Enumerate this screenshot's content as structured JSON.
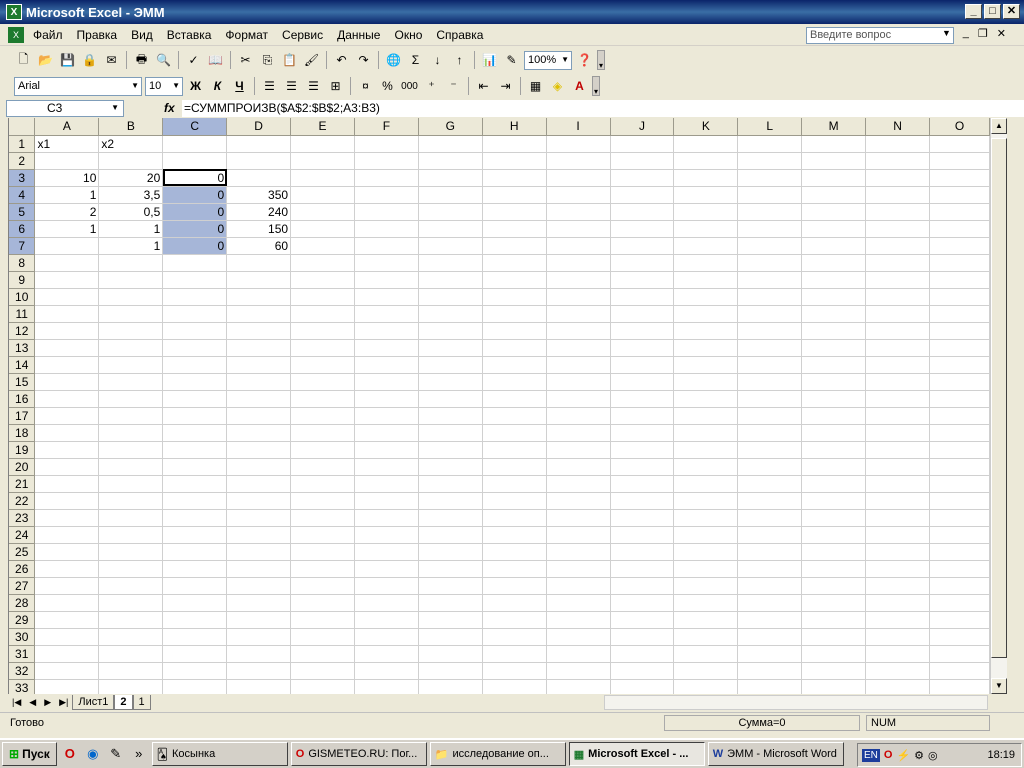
{
  "window": {
    "title": "Microsoft Excel - ЭММ",
    "min": "_",
    "max": "□",
    "close": "✕"
  },
  "menu": [
    "Файл",
    "Правка",
    "Вид",
    "Вставка",
    "Формат",
    "Сервис",
    "Данные",
    "Окно",
    "Справка"
  ],
  "ask": {
    "placeholder": "Введите вопрос"
  },
  "toolbar": {
    "zoom": "100%",
    "font": "Arial",
    "size": "10",
    "bold": "Ж",
    "italic": "К",
    "underline": "Ч",
    "percent": "%",
    "thousands": "000",
    "sigma": "Σ"
  },
  "formula_bar": {
    "name": "C3",
    "fx": "fx",
    "formula": "=СУММПРОИЗВ($A$2:$B$2;A3:B3)"
  },
  "columns": [
    "A",
    "B",
    "C",
    "D",
    "E",
    "F",
    "G",
    "H",
    "I",
    "J",
    "K",
    "L",
    "M",
    "N",
    "O"
  ],
  "cells": {
    "A1": "x1",
    "B1": "x2",
    "A3": "10",
    "B3": "20",
    "C3": "0",
    "A4": "1",
    "B4": "3,5",
    "C4": "0",
    "D4": "350",
    "A5": "2",
    "B5": "0,5",
    "C5": "0",
    "D5": "240",
    "A6": "1",
    "B6": "1",
    "C6": "0",
    "D6": "150",
    "B7": "1",
    "C7": "0",
    "D7": "60"
  },
  "rows": 33,
  "sheets": [
    "Лист1",
    "2",
    "1"
  ],
  "active_sheet": "2",
  "status": {
    "ready": "Готово",
    "sum": "Сумма=0",
    "num": "NUM"
  },
  "taskbar": {
    "start": "Пуск",
    "tasks": [
      "Косынка",
      "GISMETEO.RU: Пог...",
      "исследование оп...",
      "Microsoft Excel - ...",
      "ЭММ - Microsoft Word"
    ],
    "active": "Microsoft Excel - ...",
    "lang": "EN",
    "clock": "18:19"
  }
}
